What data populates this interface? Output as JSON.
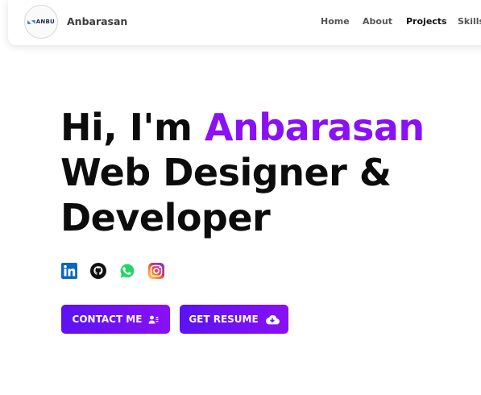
{
  "header": {
    "logo_text": "ANBU",
    "brand_name": "Anbarasan",
    "nav": [
      {
        "label": "Home"
      },
      {
        "label": "About"
      },
      {
        "label": "Projects"
      },
      {
        "label": "Skills"
      }
    ]
  },
  "hero": {
    "greeting": "Hi, I'm ",
    "name": "Anbarasan",
    "line2": "Web Designer &",
    "line3": "Developer",
    "accent_color": "#8a10f5"
  },
  "socials": [
    {
      "icon": "linkedin-icon"
    },
    {
      "icon": "github-icon"
    },
    {
      "icon": "whatsapp-icon"
    },
    {
      "icon": "instagram-icon"
    }
  ],
  "buttons": {
    "contact_label": "CONTACT ME",
    "contact_icon": "user-contact-icon",
    "resume_label": "GET RESUME",
    "resume_icon": "cloud-download-icon"
  }
}
